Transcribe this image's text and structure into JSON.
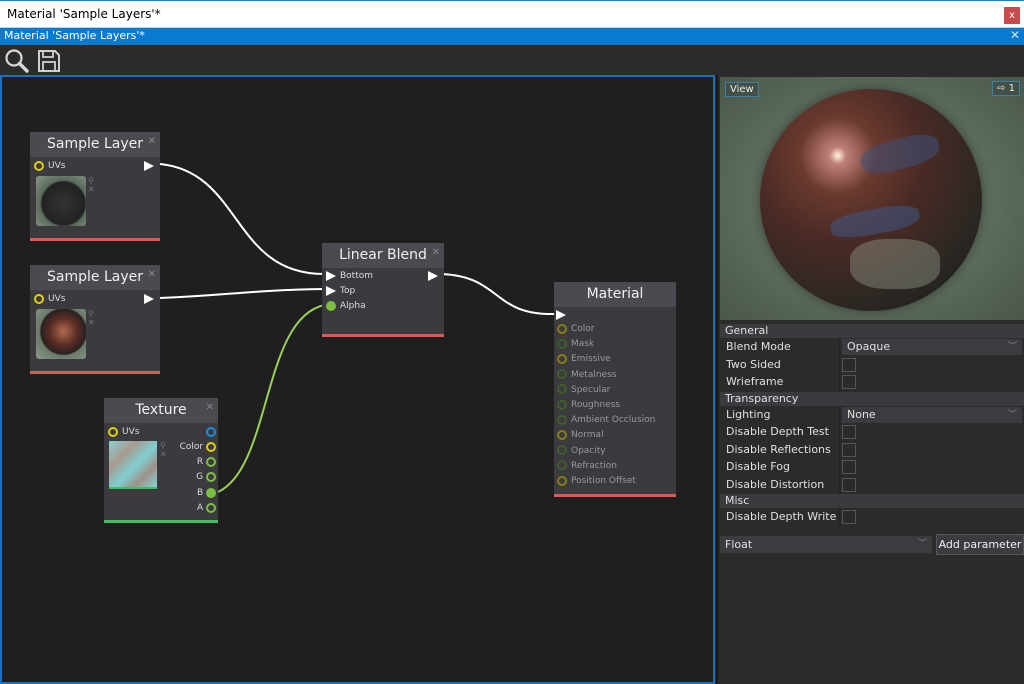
{
  "window": {
    "title": "Material 'Sample Layers'*",
    "close_label": "x"
  },
  "tab": {
    "title": "Material 'Sample Layers'*",
    "close_label": "✕"
  },
  "toolbar": {
    "icons": [
      "search-icon",
      "save-icon"
    ]
  },
  "colors": {
    "accent": "#0a7ad1",
    "canvas_border": "#1a6fc0",
    "node_footer_material": "#e05555",
    "node_footer_texture": "#3cc060",
    "port_yellow": "#e0d000",
    "port_green": "#7dc040",
    "port_blue": "#1a90d8",
    "wire_white": "#ffffff",
    "wire_green": "#9ad05a"
  },
  "nodes": {
    "sample_layer_1": {
      "title": "Sample Layer",
      "input": "UVs"
    },
    "sample_layer_2": {
      "title": "Sample Layer",
      "input": "UVs"
    },
    "texture": {
      "title": "Texture",
      "input": "UVs",
      "outputs": [
        "",
        "Color",
        "R",
        "G",
        "B",
        "A"
      ]
    },
    "linear_blend": {
      "title": "Linear Blend",
      "inputs": [
        "Bottom",
        "Top",
        "Alpha"
      ]
    },
    "material": {
      "title": "Material",
      "inputs": [
        "Color",
        "Mask",
        "Emissive",
        "Metalness",
        "Specular",
        "Roughness",
        "Ambient Occlusion",
        "Normal",
        "Opacity",
        "Refraction",
        "Position Offset"
      ]
    }
  },
  "preview": {
    "view_label": "View",
    "counter": "1"
  },
  "properties": {
    "sections": [
      {
        "title": "General",
        "rows": [
          {
            "label": "Blend Mode",
            "type": "dropdown",
            "value": "Opaque"
          },
          {
            "label": "Two Sided",
            "type": "checkbox",
            "checked": false
          },
          {
            "label": "Wrieframe",
            "type": "checkbox",
            "checked": false
          }
        ]
      },
      {
        "title": "Transparency",
        "rows": [
          {
            "label": "Lighting",
            "type": "dropdown",
            "value": "None"
          },
          {
            "label": "Disable Depth Test",
            "type": "checkbox",
            "checked": false
          },
          {
            "label": "Disable Reflections",
            "type": "checkbox",
            "checked": false
          },
          {
            "label": "Disable Fog",
            "type": "checkbox",
            "checked": false
          },
          {
            "label": "Disable Distortion",
            "type": "checkbox",
            "checked": false
          }
        ]
      },
      {
        "title": "Misc",
        "rows": [
          {
            "label": "Disable Depth Write",
            "type": "checkbox",
            "checked": false
          }
        ]
      }
    ],
    "param_type": "Float",
    "add_param_label": "Add parameter"
  }
}
